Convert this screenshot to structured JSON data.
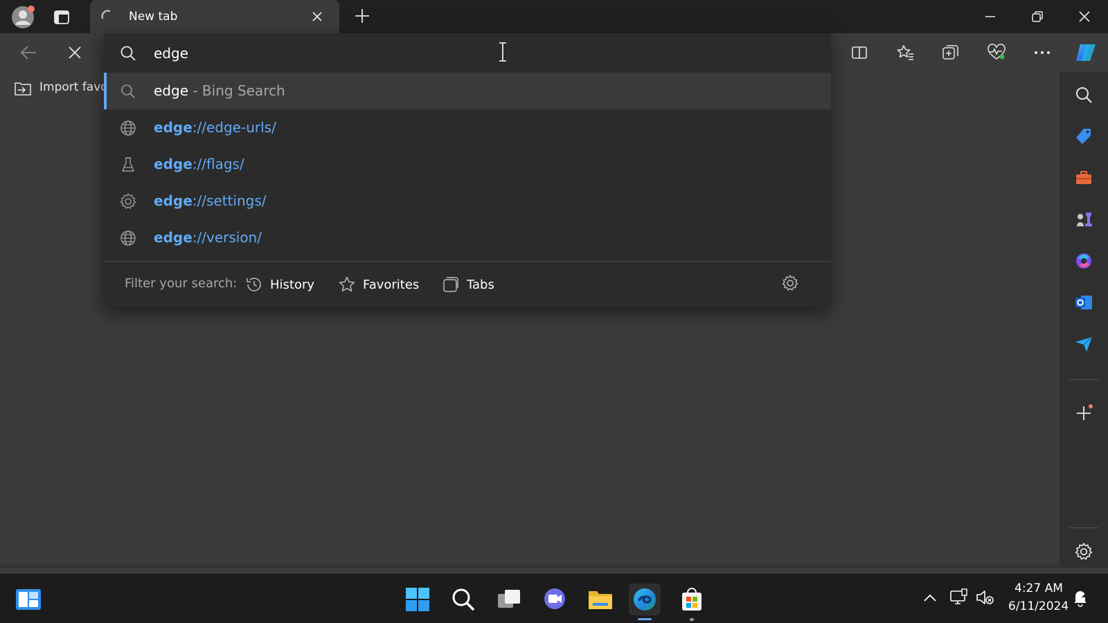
{
  "tab": {
    "title": "New tab"
  },
  "favorites_bar": {
    "import_label": "Import favo"
  },
  "omnibox": {
    "query": "edge",
    "suggestions": [
      {
        "highlight": "edge",
        "rest": " - Bing Search",
        "icon": "search-icon"
      },
      {
        "highlight": "edge",
        "rest": "://edge-urls/",
        "icon": "globe-icon"
      },
      {
        "highlight": "edge",
        "rest": "://flags/",
        "icon": "flask-icon"
      },
      {
        "highlight": "edge",
        "rest": "://settings/",
        "icon": "gear-icon"
      },
      {
        "highlight": "edge",
        "rest": "://version/",
        "icon": "globe-icon"
      }
    ],
    "filter_label": "Filter your search:",
    "filters": [
      {
        "label": "History",
        "icon": "history-icon"
      },
      {
        "label": "Favorites",
        "icon": "star-icon"
      },
      {
        "label": "Tabs",
        "icon": "tabs-icon"
      }
    ]
  },
  "taskbar": {
    "time": "4:27 AM",
    "date": "6/11/2024"
  },
  "colors": {
    "accent": "#61aaf5",
    "background": "#3b3b3b",
    "titlebar": "#202020",
    "dropdown": "#2b2b2b"
  }
}
